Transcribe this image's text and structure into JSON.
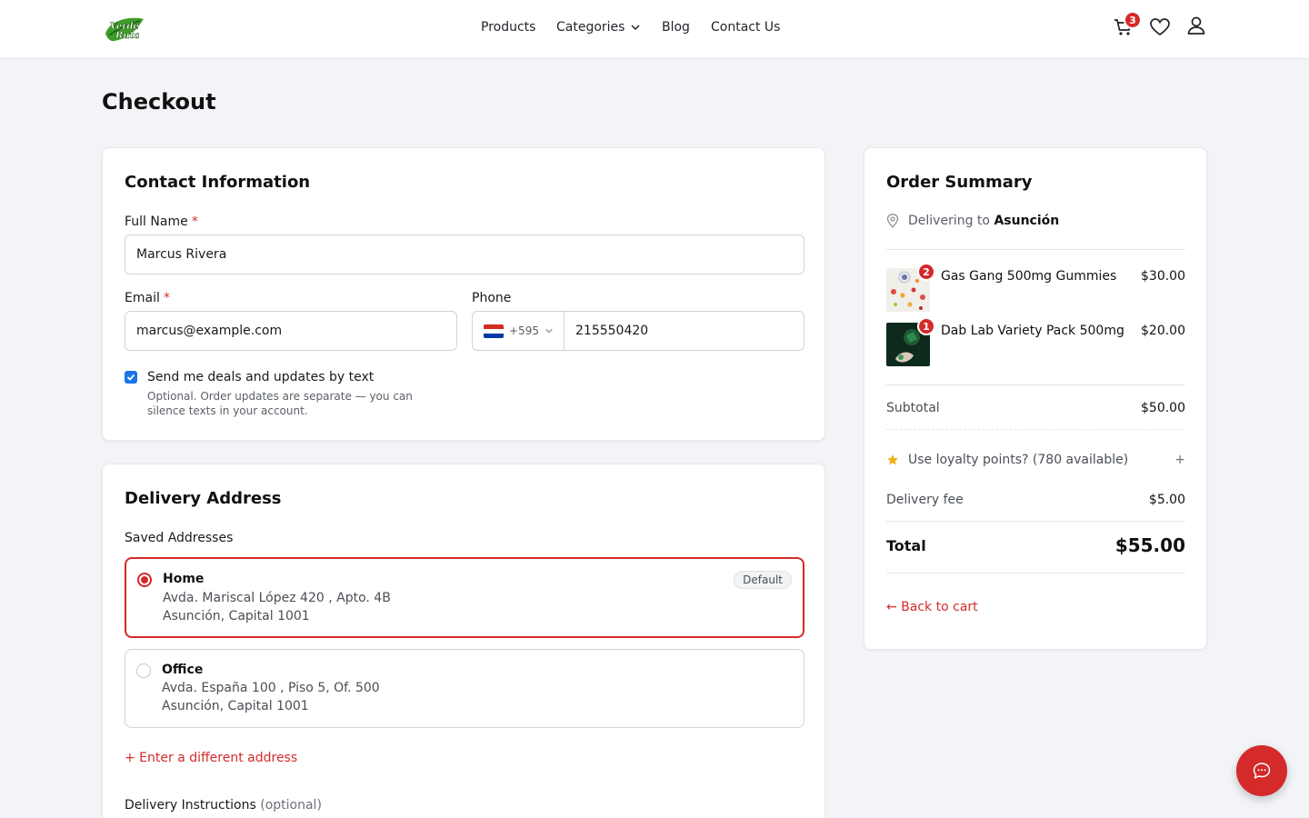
{
  "brand": {
    "logo_text": "Verde Ruta"
  },
  "nav": {
    "products": "Products",
    "categories": "Categories",
    "blog": "Blog",
    "contact": "Contact Us"
  },
  "header": {
    "cart_count": "3"
  },
  "page": {
    "title": "Checkout"
  },
  "contact": {
    "title": "Contact Information",
    "full_name_label": "Full Name",
    "full_name_value": "Marcus Rivera",
    "email_label": "Email",
    "email_value": "marcus@example.com",
    "phone_label": "Phone",
    "phone_code": "+595",
    "phone_value": "215550420",
    "required_mark": "*",
    "sms_optin_label": "Send me deals and updates by text",
    "sms_optin_checked": true,
    "sms_optin_help": "Optional. Order updates are separate — you can silence texts in your account."
  },
  "delivery": {
    "title": "Delivery Address",
    "saved_label": "Saved Addresses",
    "addresses": [
      {
        "name": "Home",
        "line1": "Avda. Mariscal López 420 , Apto. 4B",
        "line2": "Asunción, Capital 1001",
        "badge": "Default",
        "selected": true
      },
      {
        "name": "Office",
        "line1": "Avda. España 100 , Piso 5, Of. 500",
        "line2": "Asunción, Capital 1001",
        "selected": false
      }
    ],
    "different_address_link": "+ Enter a different address",
    "instructions_label": "Delivery Instructions",
    "instructions_optional": "(optional)"
  },
  "summary": {
    "title": "Order Summary",
    "delivering_prefix": "Delivering to",
    "delivering_city": "Asunción",
    "items": [
      {
        "name": "Gas Gang 500mg Gummies",
        "price": "$30.00",
        "qty": "2"
      },
      {
        "name": "Dab Lab Variety Pack 500mg",
        "price": "$20.00",
        "qty": "1"
      }
    ],
    "subtotal_label": "Subtotal",
    "subtotal_value": "$50.00",
    "loyalty_label": "Use loyalty points? (780 available)",
    "loyalty_toggle": "+",
    "delivery_fee_label": "Delivery fee",
    "delivery_fee_value": "$5.00",
    "total_label": "Total",
    "total_value": "$55.00",
    "back_link": "← Back to cart"
  },
  "colors": {
    "accent": "#d42a2a",
    "checkbox": "#1a73e8",
    "page_bg": "#f2f4f7"
  }
}
